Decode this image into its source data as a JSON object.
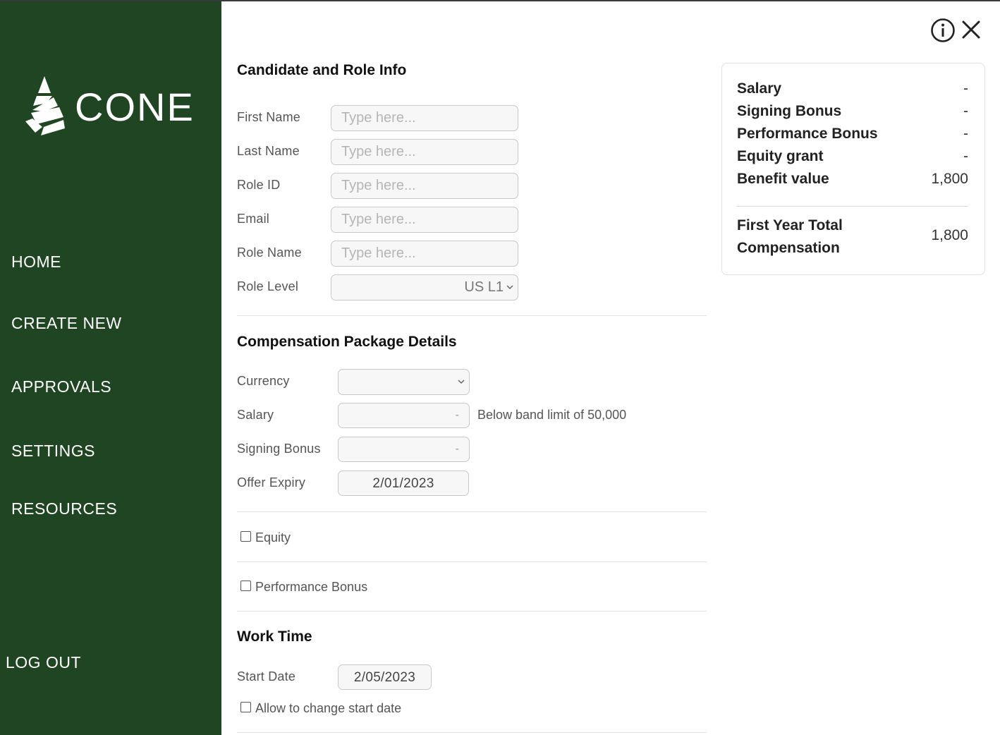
{
  "app": {
    "brand": "CONE"
  },
  "nav": {
    "home": "HOME",
    "create_new": "CREATE NEW",
    "approvals": "APPROVALS",
    "settings": "SETTINGS",
    "resources": "RESOURCES",
    "logout": "LOG OUT"
  },
  "header_icons": {
    "info": "info-icon",
    "close": "close-icon"
  },
  "candidate": {
    "title": "Candidate and Role Info",
    "first_name_label": "First Name",
    "last_name_label": "Last Name",
    "role_id_label": "Role ID",
    "email_label": "Email",
    "role_name_label": "Role Name",
    "role_level_label": "Role Level",
    "placeholder": "Type here...",
    "role_level_value": "US L1"
  },
  "compensation": {
    "title": "Compensation Package Details",
    "currency_label": "Currency",
    "currency_value": "",
    "salary_label": "Salary",
    "salary_value": "-",
    "salary_note": "Below band limit of 50,000",
    "signing_bonus_label": "Signing Bonus",
    "signing_bonus_value": "-",
    "offer_expiry_label": "Offer Expiry",
    "offer_expiry_value": "2/01/2023"
  },
  "options": {
    "equity_label": "Equity",
    "equity_checked": false,
    "performance_bonus_label": "Performance Bonus",
    "performance_bonus_checked": false
  },
  "work_time": {
    "title": "Work Time",
    "start_date_label": "Start Date",
    "start_date_value": "2/05/2023",
    "allow_change_label": "Allow to change start date",
    "allow_change_checked": false
  },
  "summary": {
    "rows": [
      {
        "label": "Salary",
        "value": "-"
      },
      {
        "label": "Signing Bonus",
        "value": "-"
      },
      {
        "label": "Performance Bonus",
        "value": "-"
      },
      {
        "label": "Equity grant",
        "value": "-"
      },
      {
        "label": "Benefit value",
        "value": "1,800"
      }
    ],
    "total_label": "First Year Total Compensation",
    "total_value": "1,800"
  },
  "colors": {
    "sidebar": "#1f4522",
    "text": "#1a1a1a",
    "muted": "#555555"
  }
}
